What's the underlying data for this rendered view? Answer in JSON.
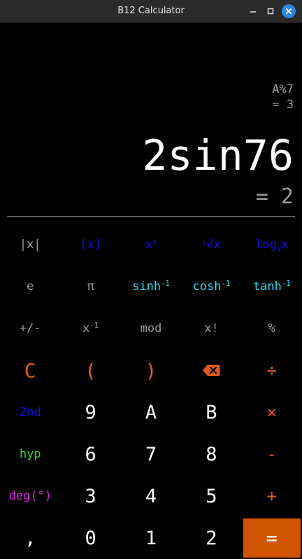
{
  "window": {
    "title": "B12 Calculator"
  },
  "display": {
    "history_expression": "A%7",
    "history_result": "= 3",
    "expression": "2sin76",
    "result": "= 2"
  },
  "keys": {
    "abs": "|x|",
    "floor": "⌊x⌋",
    "power_base": "x",
    "power_exp": "y",
    "root_index": "y",
    "root_body": "√x",
    "log_base": "log",
    "log_sub": "y",
    "log_arg": "x",
    "e": "e",
    "pi": "π",
    "sinh": "sinh",
    "cosh": "cosh",
    "tanh": "tanh",
    "inverse_sup": "-1",
    "negate": "+/-",
    "reciprocal_base": "x",
    "reciprocal_sup": "-1",
    "mod": "mod",
    "factorial": "x!",
    "percent": "%",
    "clear": "C",
    "paren_open": "(",
    "paren_close": ")",
    "divide": "÷",
    "second": "2nd",
    "nine": "9",
    "a": "A",
    "b": "B",
    "multiply": "×",
    "hyp": "hyp",
    "six": "6",
    "seven": "7",
    "eight": "8",
    "minus": "-",
    "deg": "deg(°)",
    "three": "3",
    "four": "4",
    "five": "5",
    "plus": "+",
    "comma": ",",
    "zero": "0",
    "one": "1",
    "two": "2",
    "equals": "="
  },
  "colors": {
    "background": "#000000",
    "accent": "#d35400",
    "function_blue": "#1010e6",
    "hyperbolic_cyan": "#22e0f2",
    "operator_orange": "#e2581b",
    "hyp_green": "#38d838",
    "deg_magenta": "#e020e0",
    "secondary_text": "#9a9a9a"
  },
  "icons": {
    "backspace": "backspace-icon",
    "minimize": "minimize-icon",
    "maximize": "maximize-icon",
    "close": "close-icon"
  }
}
